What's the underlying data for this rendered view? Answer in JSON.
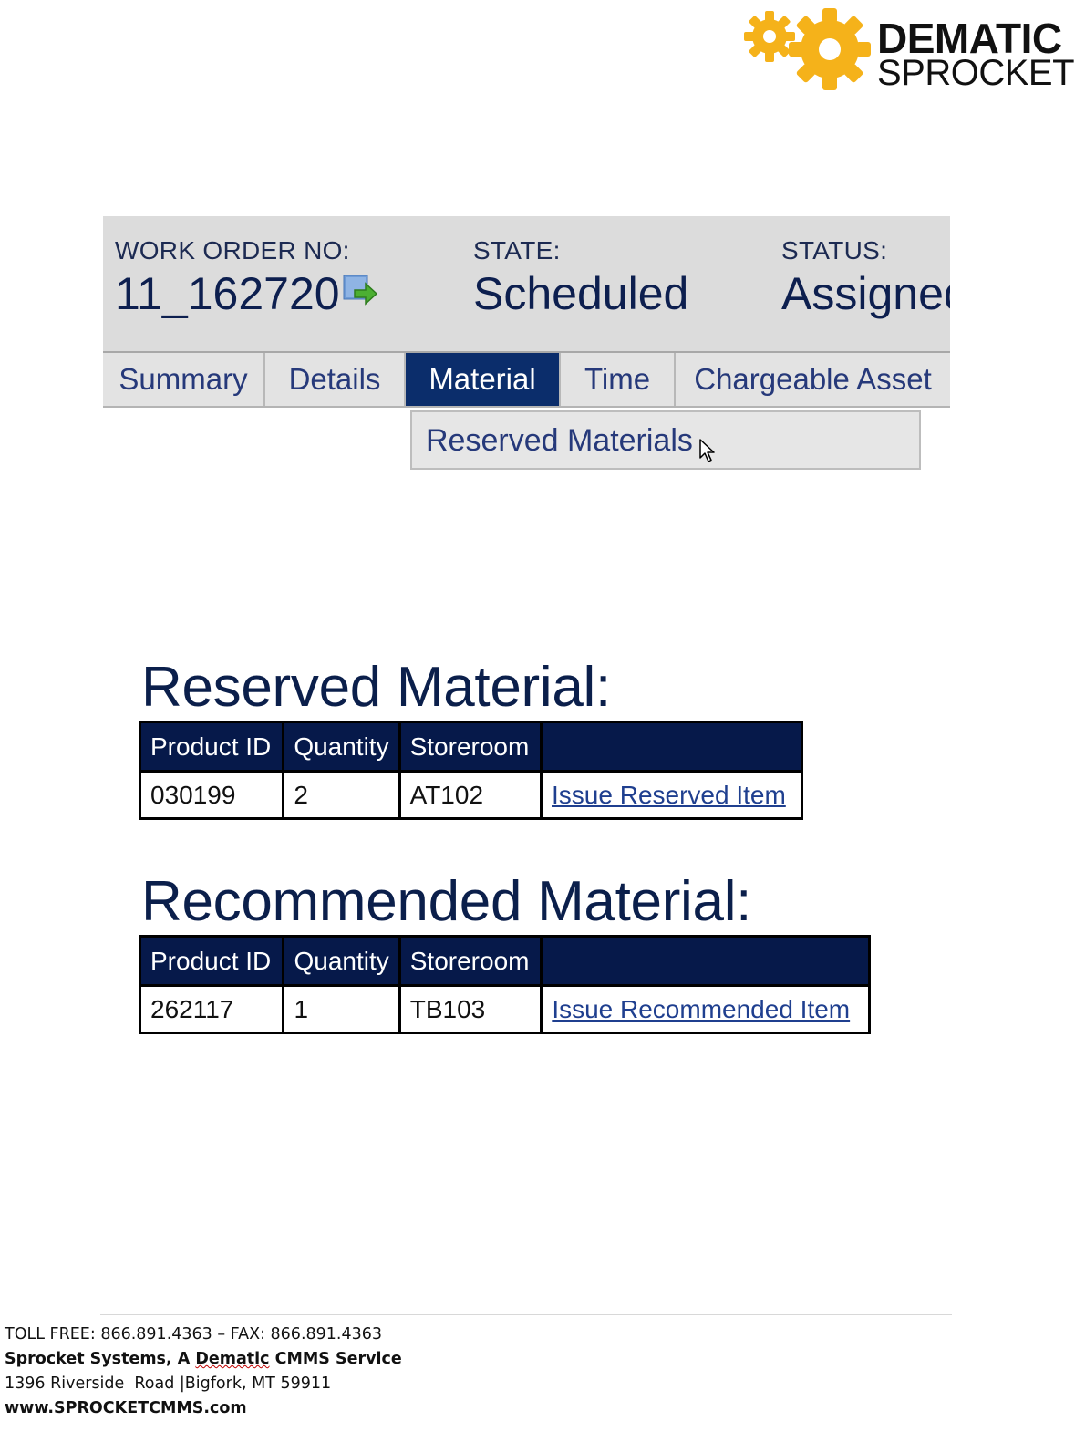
{
  "brand": {
    "line1": "DEMATIC",
    "line2": "SPROCKET",
    "gear_color": "#f5b21a"
  },
  "work_order": {
    "number_label": "WORK ORDER NO:",
    "number": "11_162720",
    "state_label": "STATE:",
    "state": "Scheduled",
    "status_label": "STATUS:",
    "status": "Assigned"
  },
  "tabs": [
    {
      "label": "Summary",
      "active": false
    },
    {
      "label": "Details",
      "active": false
    },
    {
      "label": "Material",
      "active": true
    },
    {
      "label": "Time",
      "active": false
    },
    {
      "label": "Chargeable Asset",
      "active": false
    }
  ],
  "dropdown": {
    "item": "Reserved Materials"
  },
  "reserved": {
    "title": "Reserved Material:",
    "headers": [
      "Product ID",
      "Quantity",
      "Storeroom",
      ""
    ],
    "rows": [
      {
        "product_id": "030199",
        "quantity": "2",
        "storeroom": "AT102",
        "action": "Issue Reserved Item"
      }
    ]
  },
  "recommended": {
    "title": "Recommended Material:",
    "headers": [
      "Product ID",
      "Quantity",
      "Storeroom",
      ""
    ],
    "rows": [
      {
        "product_id": "262117",
        "quantity": "1",
        "storeroom": "TB103",
        "action": "Issue Recommended Item"
      }
    ]
  },
  "footer": {
    "phone": "TOLL FREE: 866.891.4363 – FAX: 866.891.4363",
    "company_prefix": "Sprocket Systems, A ",
    "company_mid": "Dematic",
    "company_suffix": " CMMS Service",
    "address": "1396 Riverside  Road |Bigfork, MT 59911",
    "website": "www.SPROCKETCMMS.com"
  },
  "colors": {
    "navy": "#06194a",
    "tab_active": "#0b2d6b",
    "link": "#1f3f8f",
    "panel_gray": "#dcdcdc"
  }
}
